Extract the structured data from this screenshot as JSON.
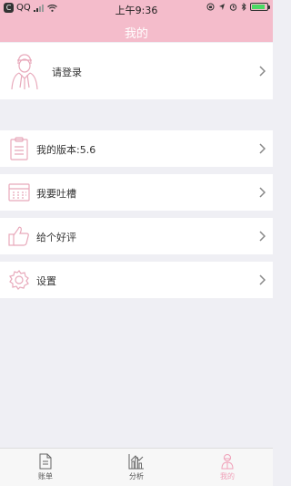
{
  "status_bar": {
    "carrier": "QQ",
    "time": "上午9:36"
  },
  "header": {
    "title": "我的"
  },
  "login_row": {
    "label": "请登录",
    "icon": "user-avatar-icon"
  },
  "menu": [
    {
      "label": "我的版本:5.6",
      "icon": "clipboard-icon"
    },
    {
      "label": "我要吐槽",
      "icon": "calendar-grid-icon"
    },
    {
      "label": "给个好评",
      "icon": "thumbs-up-icon"
    },
    {
      "label": "设置",
      "icon": "gear-icon"
    }
  ],
  "tabs": [
    {
      "label": "账单",
      "icon": "document-icon",
      "active": false
    },
    {
      "label": "分析",
      "icon": "chart-icon",
      "active": false
    },
    {
      "label": "我的",
      "icon": "person-icon",
      "active": true
    }
  ],
  "colors": {
    "accent": "#f4bccb",
    "accent_dark": "#f0a0b8",
    "bg": "#efeff4"
  }
}
